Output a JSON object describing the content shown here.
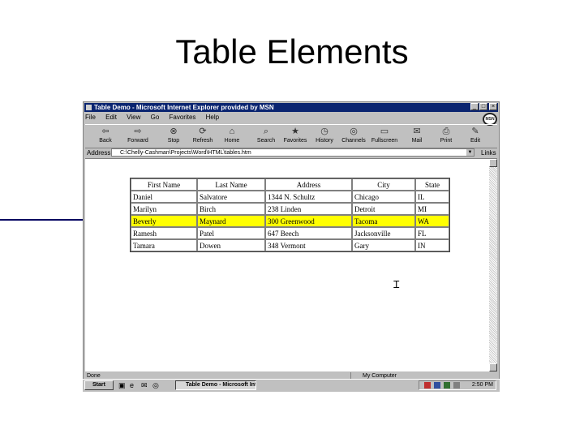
{
  "slide": {
    "title": "Table Elements"
  },
  "window": {
    "title": "Table Demo - Microsoft Internet Explorer provided by MSN",
    "controls": {
      "minimize": "_",
      "maximize": "□",
      "close": "×"
    },
    "logo": "MSN"
  },
  "menu": [
    "File",
    "Edit",
    "View",
    "Go",
    "Favorites",
    "Help"
  ],
  "toolbar": [
    {
      "label": "Back",
      "icon": "back-arrow-icon",
      "glyph": "⇦"
    },
    {
      "label": "Forward",
      "icon": "forward-arrow-icon",
      "glyph": "⇨"
    },
    {
      "label": "Stop",
      "icon": "stop-icon",
      "glyph": "⊗"
    },
    {
      "label": "Refresh",
      "icon": "refresh-icon",
      "glyph": "⟳"
    },
    {
      "label": "Home",
      "icon": "home-icon",
      "glyph": "⌂"
    },
    {
      "label": "Search",
      "icon": "search-icon",
      "glyph": "⌕"
    },
    {
      "label": "Favorites",
      "icon": "favorites-icon",
      "glyph": "★"
    },
    {
      "label": "History",
      "icon": "history-icon",
      "glyph": "◷"
    },
    {
      "label": "Channels",
      "icon": "channels-icon",
      "glyph": "◎"
    },
    {
      "label": "Fullscreen",
      "icon": "fullscreen-icon",
      "glyph": "▭"
    },
    {
      "label": "Mail",
      "icon": "mail-icon",
      "glyph": "✉"
    },
    {
      "label": "Print",
      "icon": "print-icon",
      "glyph": "⎙"
    },
    {
      "label": "Edit",
      "icon": "edit-icon",
      "glyph": "✎"
    }
  ],
  "address": {
    "label": "Address",
    "value": "C:\\Chelly-Cashman\\Projects\\Word\\HTML\\tables.htm",
    "links_label": "Links"
  },
  "table": {
    "headers": [
      "First Name",
      "Last Name",
      "Address",
      "City",
      "State"
    ],
    "rows": [
      [
        "Daniel",
        "Salvatore",
        "1344 N. Schultz",
        "Chicago",
        "IL"
      ],
      [
        "Marilyn",
        "Birch",
        "238 Linden",
        "Detroit",
        "MI"
      ],
      [
        "Beverly",
        "Maynard",
        "300 Greenwood",
        "Tacoma",
        "WA"
      ],
      [
        "Ramesh",
        "Patel",
        "647 Beech",
        "Jacksonville",
        "FL"
      ],
      [
        "Tamara",
        "Dowen",
        "348 Vermont",
        "Gary",
        "IN"
      ]
    ],
    "selected_row": 2,
    "highlight_color": "#ffff00"
  },
  "status": {
    "left": "Done",
    "zone": "My Computer"
  },
  "taskbar": {
    "start": "Start",
    "task": "Table Demo - Microsoft Internet Explorer",
    "clock": "2:50 PM"
  },
  "colors": {
    "titlebar": "#0a2470",
    "chrome": "#c0c0c0",
    "arrow": "#000060"
  }
}
